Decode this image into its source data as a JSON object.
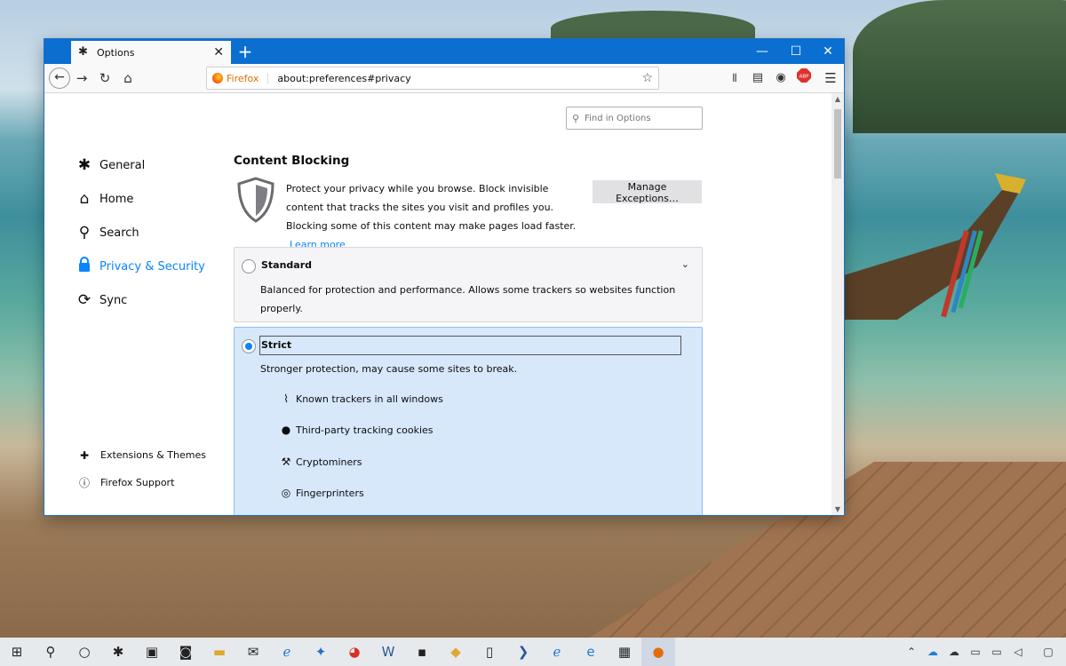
{
  "window": {
    "tab_title": "Options",
    "tab_icon": "gear-icon",
    "url_brand": "Firefox",
    "url": "about:preferences#privacy"
  },
  "search": {
    "placeholder": "Find in Options"
  },
  "sidebar": {
    "items": [
      {
        "label": "General",
        "icon": "gear-icon"
      },
      {
        "label": "Home",
        "icon": "home-icon"
      },
      {
        "label": "Search",
        "icon": "search-icon"
      },
      {
        "label": "Privacy & Security",
        "icon": "lock-icon",
        "selected": true
      },
      {
        "label": "Sync",
        "icon": "sync-icon"
      }
    ],
    "footer": [
      {
        "label": "Extensions & Themes",
        "icon": "puzzle-icon"
      },
      {
        "label": "Firefox Support",
        "icon": "help-icon"
      }
    ]
  },
  "main": {
    "heading": "Content Blocking",
    "intro": "Protect your privacy while you browse. Block invisible content that tracks the sites you visit and profiles you. Blocking some of this content may make pages load faster.",
    "learn_more": "Learn more",
    "manage_button": "Manage Exceptions…",
    "standard": {
      "title": "Standard",
      "desc": "Balanced for protection and performance. Allows some trackers so websites function properly.",
      "checked": false
    },
    "strict": {
      "title": "Strict",
      "desc": "Stronger protection, may cause some sites to break.",
      "checked": true,
      "features": [
        "Known trackers in all windows",
        "Third-party tracking cookies",
        "Cryptominers",
        "Fingerprinters"
      ]
    }
  },
  "colors": {
    "accent": "#0a84ff",
    "titlebar": "#0a6fd0",
    "strict_bg": "#d7e8fb"
  }
}
